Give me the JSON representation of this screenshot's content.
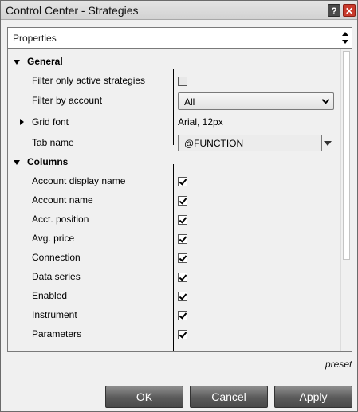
{
  "window": {
    "title": "Control Center - Strategies",
    "help_label": "?",
    "close_label": "✕"
  },
  "properties": {
    "header_label": "Properties"
  },
  "general": {
    "label": "General",
    "filter_active": {
      "label": "Filter only active strategies",
      "checked": false
    },
    "filter_account": {
      "label": "Filter by account",
      "value": "All"
    },
    "grid_font": {
      "label": "Grid font",
      "value": "Arial, 12px"
    },
    "tab_name": {
      "label": "Tab name",
      "value": "@FUNCTION"
    }
  },
  "columns": {
    "label": "Columns",
    "items": [
      {
        "label": "Account display name",
        "checked": true
      },
      {
        "label": "Account name",
        "checked": true
      },
      {
        "label": "Acct. position",
        "checked": true
      },
      {
        "label": "Avg. price",
        "checked": true
      },
      {
        "label": "Connection",
        "checked": true
      },
      {
        "label": "Data series",
        "checked": true
      },
      {
        "label": "Enabled",
        "checked": true
      },
      {
        "label": "Instrument",
        "checked": true
      },
      {
        "label": "Parameters",
        "checked": true
      }
    ]
  },
  "footer": {
    "preset": "preset",
    "ok": "OK",
    "cancel": "Cancel",
    "apply": "Apply"
  }
}
